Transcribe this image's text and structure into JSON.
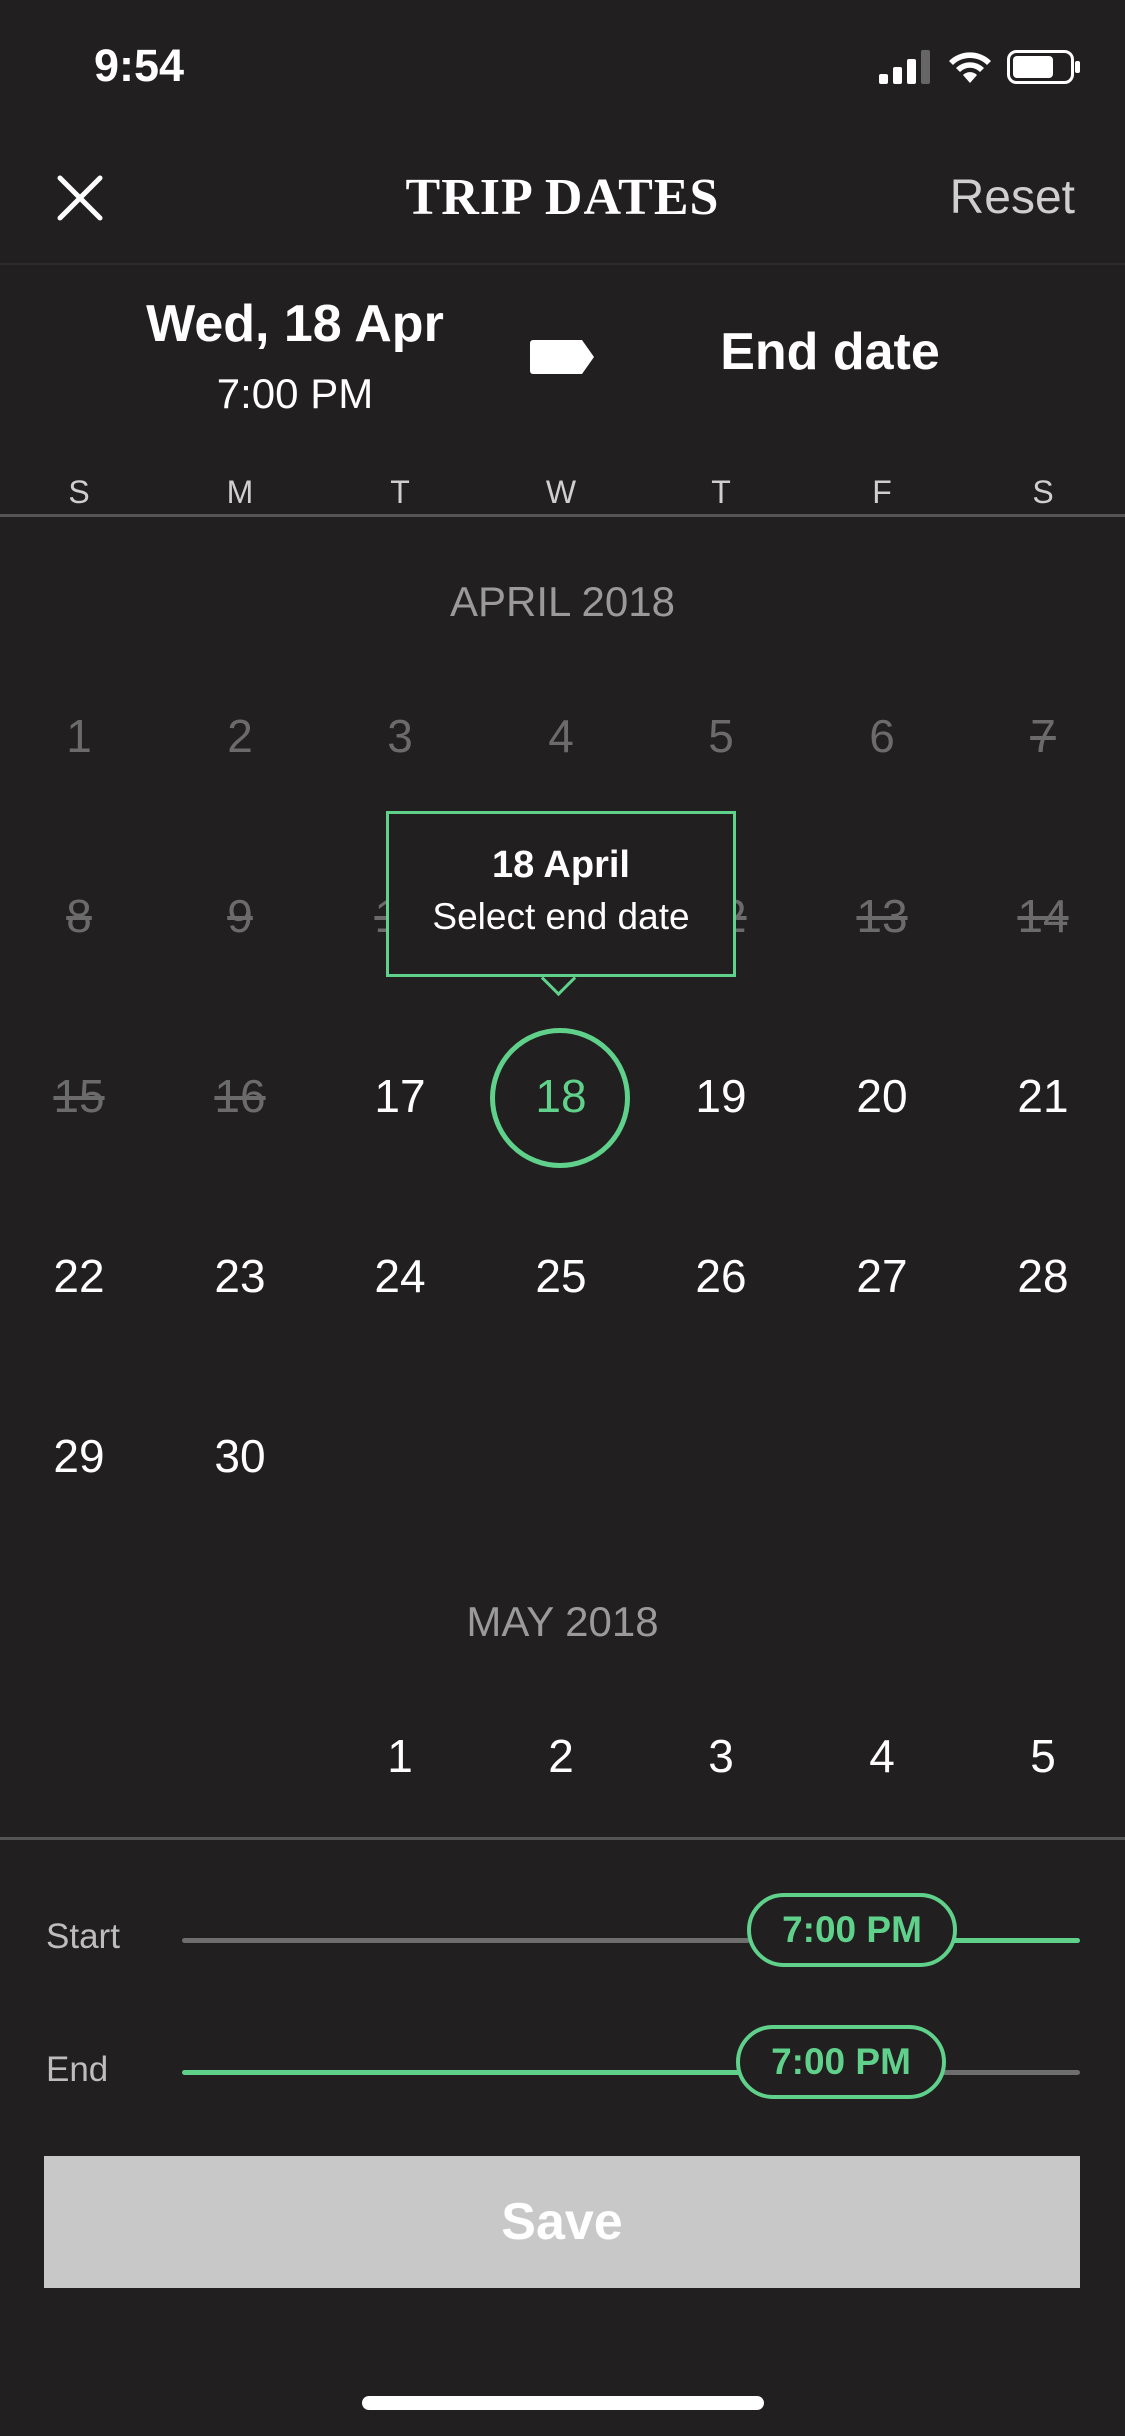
{
  "status_bar": {
    "time": "9:54",
    "icons": [
      "signal-icon",
      "wifi-icon",
      "battery-icon"
    ]
  },
  "header": {
    "title": "TRIP DATES",
    "reset_label": "Reset",
    "close_icon": "close-icon"
  },
  "summary": {
    "start_date": "Wed, 18 Apr",
    "start_time": "7:00 PM",
    "end_placeholder": "End date",
    "arrow_icon": "arrow-right-tag-icon"
  },
  "weekdays": [
    "S",
    "M",
    "T",
    "W",
    "T",
    "F",
    "S"
  ],
  "calendar": {
    "months": [
      {
        "title": "APRIL 2018",
        "weeks": [
          [
            {
              "d": "1",
              "s": "past"
            },
            {
              "d": "2",
              "s": "past"
            },
            {
              "d": "3",
              "s": "past"
            },
            {
              "d": "4",
              "s": "past"
            },
            {
              "d": "5",
              "s": "past"
            },
            {
              "d": "6",
              "s": "past"
            },
            {
              "d": "7",
              "s": "struck"
            }
          ],
          [
            {
              "d": "8",
              "s": "struck"
            },
            {
              "d": "9",
              "s": "struck"
            },
            {
              "d": "10",
              "s": "struck"
            },
            {
              "d": "11",
              "s": "struck"
            },
            {
              "d": "12",
              "s": "struck"
            },
            {
              "d": "13",
              "s": "struck"
            },
            {
              "d": "14",
              "s": "struck"
            }
          ],
          [
            {
              "d": "15",
              "s": "struck"
            },
            {
              "d": "16",
              "s": "struck"
            },
            {
              "d": "17",
              "s": "avail"
            },
            {
              "d": "18",
              "s": "selected"
            },
            {
              "d": "19",
              "s": "avail"
            },
            {
              "d": "20",
              "s": "avail"
            },
            {
              "d": "21",
              "s": "avail"
            }
          ],
          [
            {
              "d": "22",
              "s": "avail"
            },
            {
              "d": "23",
              "s": "avail"
            },
            {
              "d": "24",
              "s": "avail"
            },
            {
              "d": "25",
              "s": "avail"
            },
            {
              "d": "26",
              "s": "avail"
            },
            {
              "d": "27",
              "s": "avail"
            },
            {
              "d": "28",
              "s": "avail"
            }
          ],
          [
            {
              "d": "29",
              "s": "avail"
            },
            {
              "d": "30",
              "s": "avail"
            }
          ]
        ]
      },
      {
        "title": "MAY 2018",
        "weeks": [
          [
            null,
            null,
            {
              "d": "1",
              "s": "avail"
            },
            {
              "d": "2",
              "s": "avail"
            },
            {
              "d": "3",
              "s": "avail"
            },
            {
              "d": "4",
              "s": "avail"
            },
            {
              "d": "5",
              "s": "avail"
            }
          ]
        ]
      }
    ]
  },
  "tooltip": {
    "title": "18 April",
    "subtitle": "Select end date"
  },
  "sliders": {
    "start": {
      "label": "Start",
      "value": "7:00 PM"
    },
    "end": {
      "label": "End",
      "value": "7:00 PM"
    }
  },
  "save_label": "Save",
  "colors": {
    "background": "#221f20",
    "accent": "#5fd18b",
    "muted": "#6b6b6b",
    "button_disabled": "#c8c8c8"
  }
}
